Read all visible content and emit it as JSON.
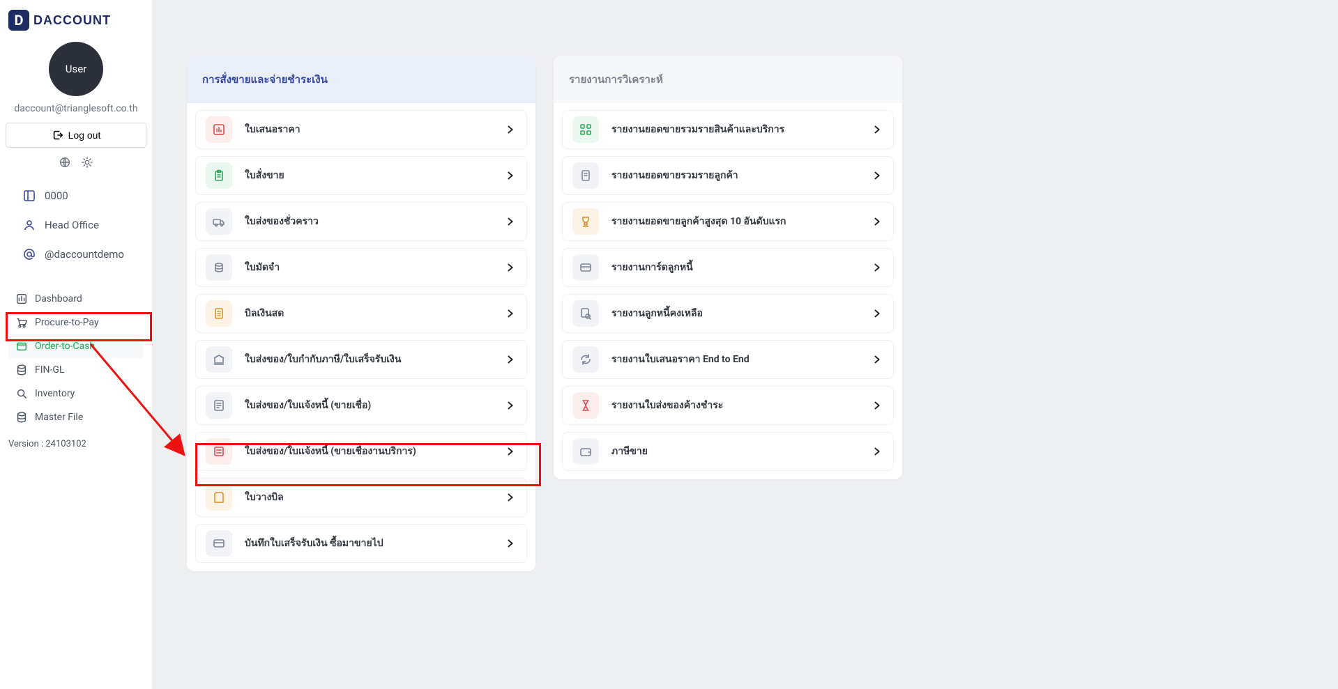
{
  "brand": {
    "mark": "D",
    "name": "DACCOUNT"
  },
  "user": {
    "avatar_label": "User",
    "email": "daccount@trianglesoft.co.th"
  },
  "logout_label": "Log out",
  "company": {
    "code": "0000",
    "branch": "Head Office",
    "handle": "@daccountdemo"
  },
  "nav": {
    "items": [
      {
        "label": "Dashboard",
        "active": false
      },
      {
        "label": "Procure-to-Pay",
        "active": false
      },
      {
        "label": "Order-to-Cash",
        "active": true
      },
      {
        "label": "FIN-GL",
        "active": false
      },
      {
        "label": "Inventory",
        "active": false
      },
      {
        "label": "Master File",
        "active": false
      }
    ]
  },
  "version_label": "Version : 24103102",
  "panels": {
    "sales": {
      "title": "การสั่งขายและจ่ายชำระเงิน",
      "items": [
        {
          "label": "ใบเสนอราคา",
          "icon": "chart-bar",
          "bg": "bg-red"
        },
        {
          "label": "ใบสั่งขาย",
          "icon": "clipboard",
          "bg": "bg-green"
        },
        {
          "label": "ใบส่งของชั่วคราว",
          "icon": "truck",
          "bg": "bg-gray"
        },
        {
          "label": "ใบมัดจำ",
          "icon": "coins",
          "bg": "bg-gray"
        },
        {
          "label": "บิลเงินสด",
          "icon": "receipt",
          "bg": "bg-orange"
        },
        {
          "label": "ใบส่งของ/ใบกำกับภาษี/ใบเสร็จรับเงิน",
          "icon": "bank",
          "bg": "bg-gray"
        },
        {
          "label": "ใบส่งของ/ใบแจ้งหนี้ (ขายเชื่อ)",
          "icon": "invoice",
          "bg": "bg-gray"
        },
        {
          "label": "ใบส่งของ/ใบแจ้งหนี้ (ขายเชื่องานบริการ)",
          "icon": "invoice-box",
          "bg": "bg-red"
        },
        {
          "label": "ใบวางบิล",
          "icon": "bill",
          "bg": "bg-orange"
        },
        {
          "label": "บันทึกใบเสร็จรับเงิน ซื้อมาขายไป",
          "icon": "card",
          "bg": "bg-gray"
        }
      ]
    },
    "analysis": {
      "title": "รายงานการวิเคราะห์",
      "items": [
        {
          "label": "รายงานยอดขายรวมรายสินค้าและบริการ",
          "icon": "grid",
          "bg": "bg-green"
        },
        {
          "label": "รายงานยอดขายรวมรายลูกค้า",
          "icon": "doc",
          "bg": "bg-gray"
        },
        {
          "label": "รายงานยอดขายลูกค้าสูงสุด 10 อันดับแรก",
          "icon": "trophy",
          "bg": "bg-orange"
        },
        {
          "label": "รายงานการ์ดลูกหนี้",
          "icon": "card",
          "bg": "bg-gray"
        },
        {
          "label": "รายงานลูกหนี้คงเหลือ",
          "icon": "search-doc",
          "bg": "bg-gray"
        },
        {
          "label": "รายงานใบเสนอราคา End to End",
          "icon": "refresh",
          "bg": "bg-gray"
        },
        {
          "label": "รายงานใบส่งของค้างชำระ",
          "icon": "hourglass",
          "bg": "bg-red"
        },
        {
          "label": "ภาษีขาย",
          "icon": "wallet",
          "bg": "bg-gray"
        }
      ]
    }
  }
}
